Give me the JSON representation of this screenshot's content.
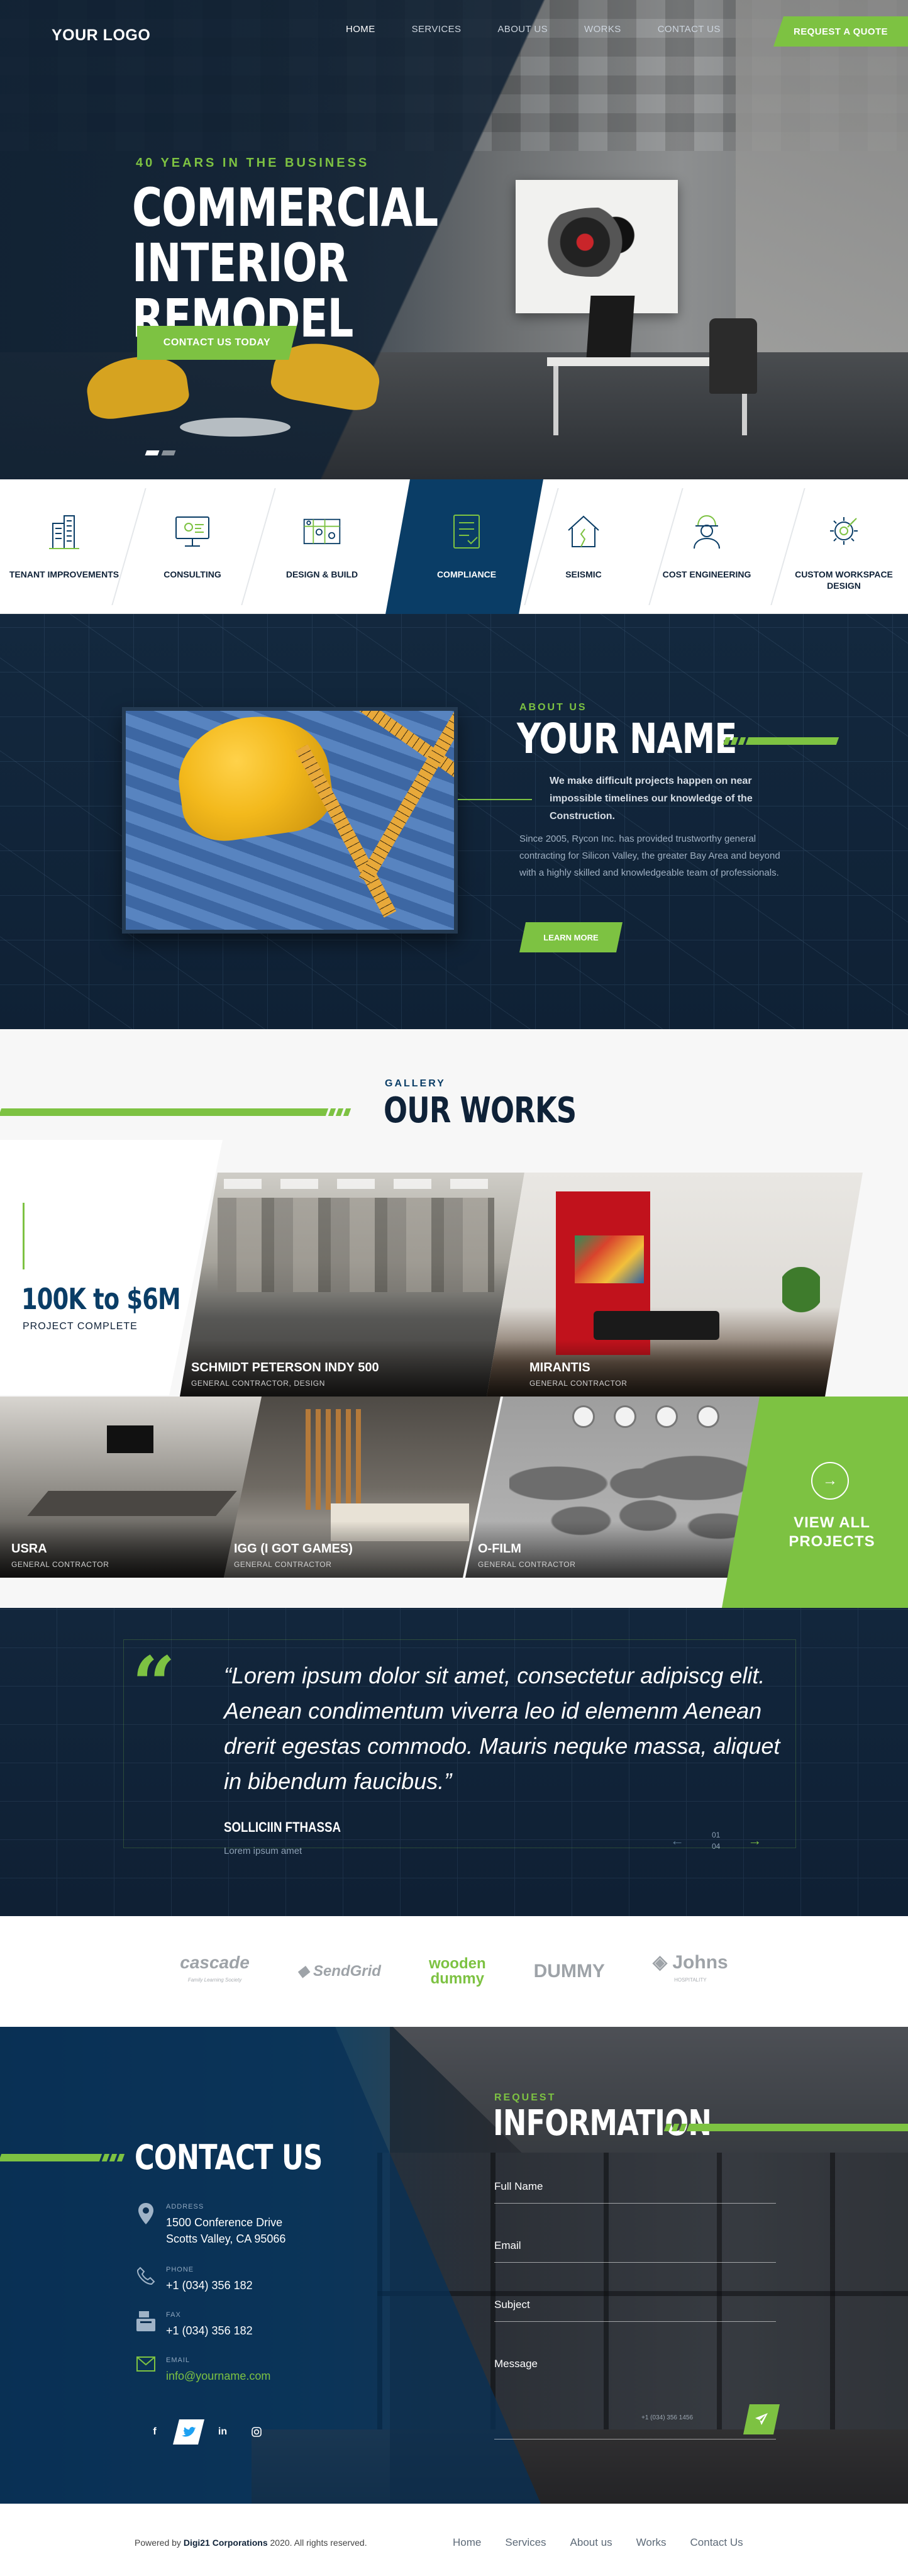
{
  "header": {
    "logo": "YOUR LOGO",
    "nav": [
      "HOME",
      "SERVICES",
      "ABOUT US",
      "WORKS",
      "CONTACT US"
    ],
    "active_nav": "HOME",
    "cta": "REQUEST A QUOTE"
  },
  "hero": {
    "eyebrow": "40 YEARS IN THE BUSINESS",
    "title_line1": "COMMERCIAL",
    "title_line2": "INTERIOR REMODEL",
    "button": "CONTACT US TODAY",
    "slide_count": 2,
    "active_slide": 1
  },
  "services": {
    "items": [
      {
        "label": "TENANT IMPROVEMENTS",
        "icon": "building-icon"
      },
      {
        "label": "CONSULTING",
        "icon": "presentation-icon"
      },
      {
        "label": "DESIGN & BUILD",
        "icon": "blueprint-icon"
      },
      {
        "label": "COMPLIANCE",
        "icon": "checklist-icon"
      },
      {
        "label": "SEISMIC",
        "icon": "house-crack-icon"
      },
      {
        "label": "COST ENGINEERING",
        "icon": "engineer-icon"
      },
      {
        "label": "CUSTOM WORKSPACE DESIGN",
        "icon": "gear-wrench-icon"
      }
    ],
    "active": "COMPLIANCE"
  },
  "about": {
    "eyebrow": "ABOUT US",
    "title": "YOUR NAME",
    "lead": "We make difficult projects happen on near impossible timelines our knowledge of the Construction.",
    "body": "Since 2005, Rycon Inc. has provided trustworthy general contracting for Silicon Valley, the greater Bay Area and beyond with a highly skilled and knowledgeable team of professionals.",
    "button": "LEARN MORE"
  },
  "gallery": {
    "eyebrow": "GALLERY",
    "title": "OUR WORKS",
    "stat_value": "100K to $6M",
    "stat_label": "PROJECT COMPLETE",
    "works": [
      {
        "name": "SCHMIDT PETERSON INDY 500",
        "sub": "GENERAL CONTRACTOR, DESIGN"
      },
      {
        "name": "MIRANTIS",
        "sub": "GENERAL CONTRACTOR"
      },
      {
        "name": "USRA",
        "sub": "GENERAL CONTRACTOR"
      },
      {
        "name": "IGG (I GOT GAMES)",
        "sub": "GENERAL CONTRACTOR"
      },
      {
        "name": "O-FILM",
        "sub": "GENERAL CONTRACTOR"
      }
    ],
    "view_all": "VIEW ALL PROJECTS"
  },
  "testimonial": {
    "quote": "“Lorem ipsum dolor sit amet, consectetur adipiscg elit. Aenean condimentum viverra leo id elemenm Aenean  drerit egestas commodo. Mauris nequke massa, aliquet in bibendum faucibus.”",
    "author": "SOLLICIIN FTHASSA",
    "role": "Lorem ipsum amet",
    "current": "01",
    "total": "04"
  },
  "clients": {
    "logos": [
      {
        "name": "cascade",
        "tagline": "Family Learning Society"
      },
      {
        "name": "SendGrid",
        "tagline": ""
      },
      {
        "name_line1": "wooden",
        "name_line2": "dummy"
      },
      {
        "name": "DUMMY",
        "tagline": ""
      },
      {
        "name": "Johns",
        "tagline": "HOSPITALITY"
      }
    ]
  },
  "contact": {
    "title": "CONTACT US",
    "address_label": "ADDRESS",
    "address_line1": "1500 Conference Drive",
    "address_line2": "Scotts Valley, CA 95066",
    "phone_label": "PHONE",
    "phone": "+1 (034) 356 182",
    "fax_label": "FAX",
    "fax": "+1 (034) 356 182",
    "email_label": "EMAIL",
    "email": "info@yourname.com",
    "socials": [
      "f",
      "t",
      "in",
      "ig"
    ]
  },
  "request": {
    "eyebrow": "REQUEST",
    "title": "INFORMATION",
    "fields": {
      "full_name": "Full Name",
      "email": "Email",
      "subject": "Subject",
      "message": "Message"
    },
    "note": "+1 (034) 356 1456"
  },
  "footer": {
    "copy_prefix": "Powered by",
    "company": "Digi21 Corporations",
    "copy_suffix": "2020. All rights reserved.",
    "nav": [
      "Home",
      "Services",
      "About us",
      "Works",
      "Contact Us"
    ]
  },
  "colors": {
    "accent": "#7dc242",
    "navy": "#0a3d66",
    "dark": "#0f2238"
  }
}
